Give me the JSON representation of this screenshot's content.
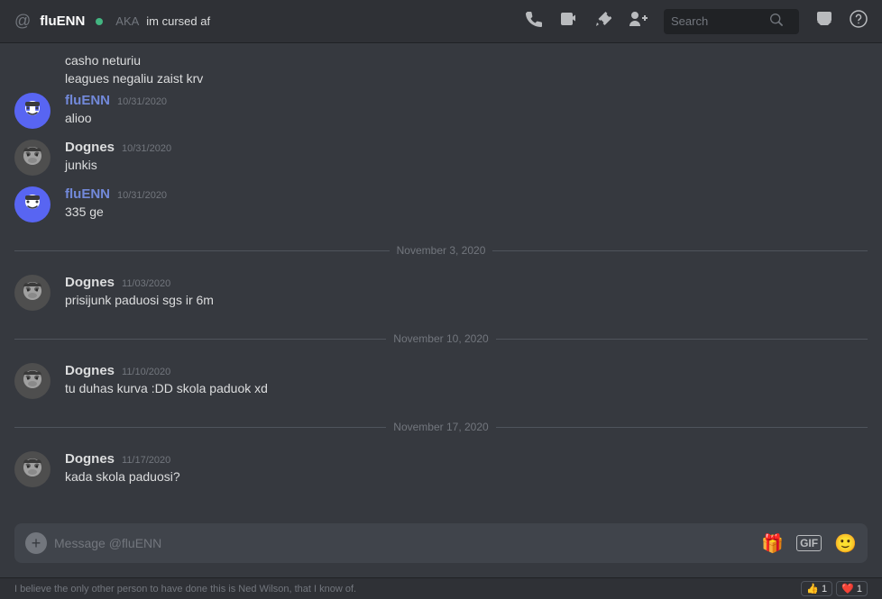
{
  "header": {
    "at_symbol": "@",
    "username": "fluENN",
    "status_dot_color": "#43b581",
    "aka_label": "AKA",
    "aka_value": "im cursed af",
    "search_placeholder": "Search",
    "icons": {
      "phone": "📞",
      "video": "📷",
      "pin": "📌",
      "add_friend": "👤+",
      "search": "🔍",
      "inbox": "📥",
      "help": "?"
    }
  },
  "messages": [
    {
      "type": "continuation",
      "lines": [
        "casho neturiu",
        "leagues negaliu zaist krv"
      ]
    },
    {
      "type": "group",
      "avatar": "fluenn",
      "username": "fluENN",
      "username_class": "username-fluenn",
      "timestamp": "10/31/2020",
      "lines": [
        "alioo"
      ]
    },
    {
      "type": "group",
      "avatar": "dognes",
      "username": "Dognes",
      "username_class": "username-dognes",
      "timestamp": "10/31/2020",
      "lines": [
        "junkis"
      ]
    },
    {
      "type": "group",
      "avatar": "fluenn",
      "username": "fluENN",
      "username_class": "username-fluenn",
      "timestamp": "10/31/2020",
      "lines": [
        "335 ge"
      ]
    },
    {
      "type": "divider",
      "text": "November 3, 2020"
    },
    {
      "type": "group",
      "avatar": "dognes",
      "username": "Dognes",
      "username_class": "username-dognes",
      "timestamp": "11/03/2020",
      "lines": [
        "prisijunk paduosi sgs ir 6m"
      ]
    },
    {
      "type": "divider",
      "text": "November 10, 2020"
    },
    {
      "type": "group",
      "avatar": "dognes",
      "username": "Dognes",
      "username_class": "username-dognes",
      "timestamp": "11/10/2020",
      "lines": [
        "tu duhas kurva :DD skola paduok xd"
      ]
    },
    {
      "type": "divider",
      "text": "November 17, 2020"
    },
    {
      "type": "group",
      "avatar": "dognes",
      "username": "Dognes",
      "username_class": "username-dognes",
      "timestamp": "11/17/2020",
      "lines": [
        "kada skola paduosi?"
      ]
    }
  ],
  "input": {
    "placeholder": "Message @fluENN",
    "plus_label": "+",
    "gift_label": "🎁",
    "gif_label": "GIF",
    "emoji_label": "🙂"
  },
  "bottom_bar": {
    "text": "I believe the only other person to have done this is Ned Wilson, that I know of."
  }
}
